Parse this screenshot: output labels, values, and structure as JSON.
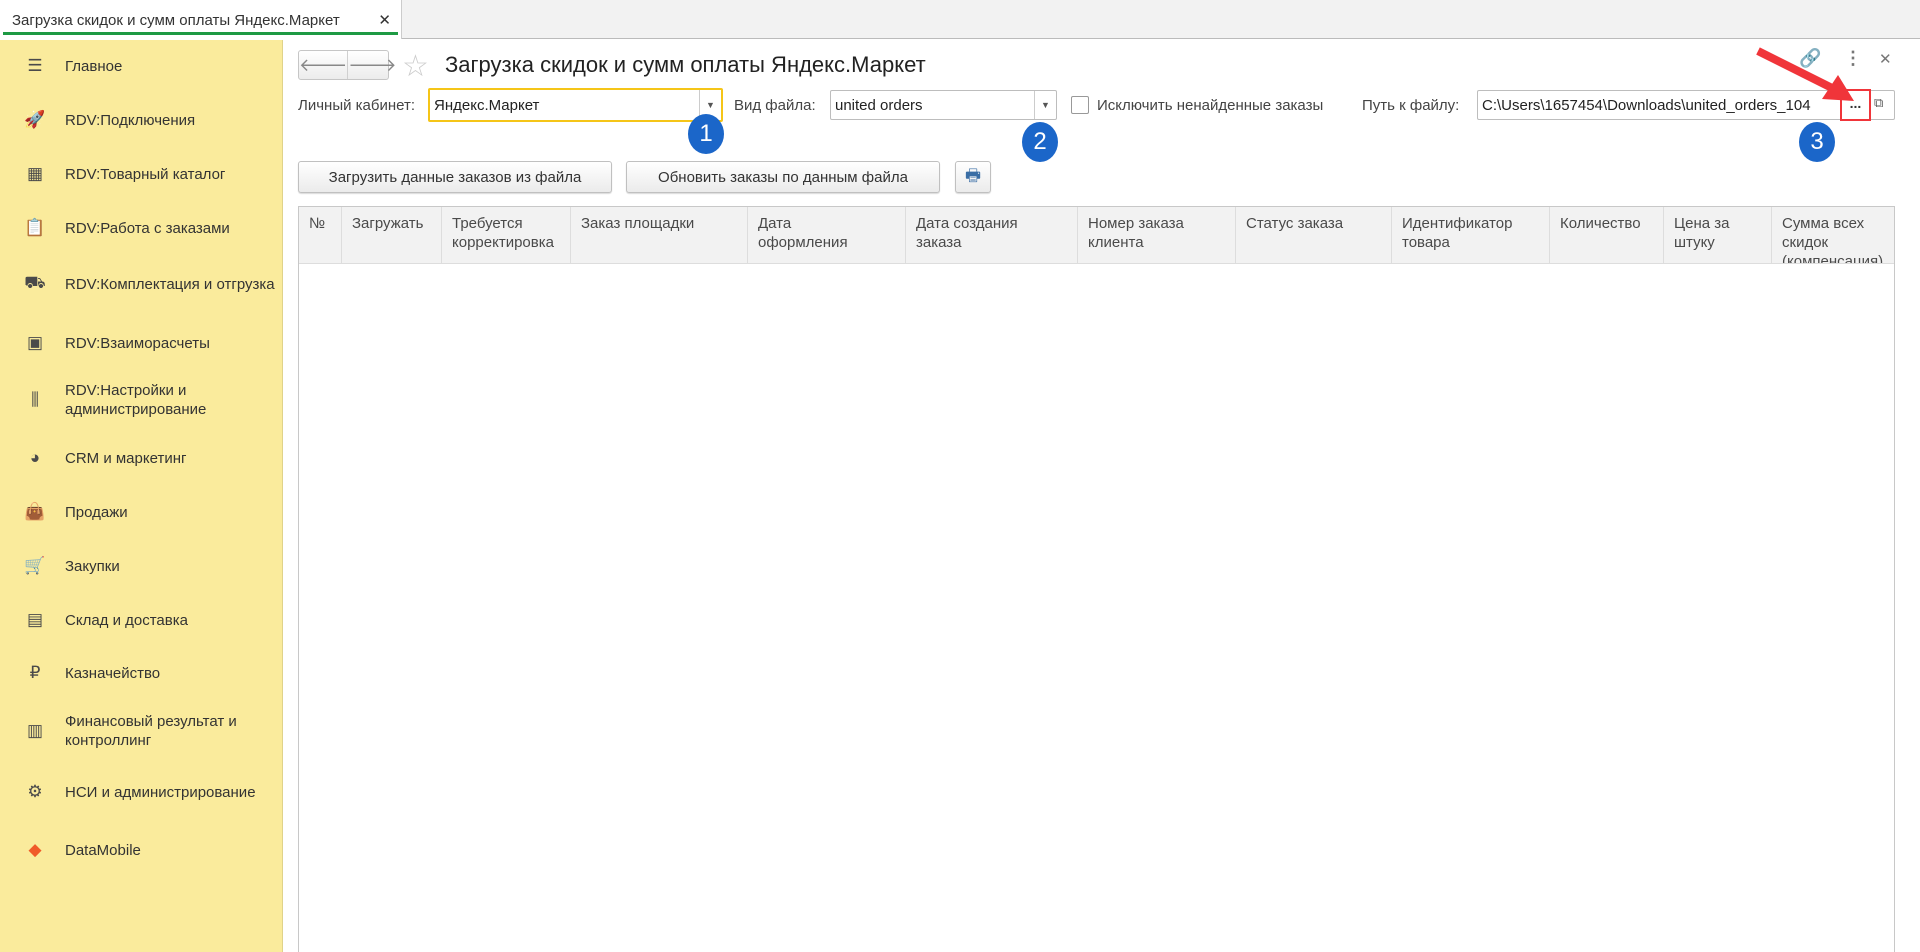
{
  "tab": {
    "title": "Загрузка скидок и сумм оплаты Яндекс.Маркет",
    "close": "✕"
  },
  "sidebar": {
    "items": [
      {
        "label": "Главное",
        "icon": "menu-icon"
      },
      {
        "label": "RDV:Подключения",
        "icon": "rocket-icon"
      },
      {
        "label": "RDV:Товарный каталог",
        "icon": "catalog-icon"
      },
      {
        "label": "RDV:Работа с заказами",
        "icon": "orders-icon"
      },
      {
        "label": "RDV:Комплектация и отгрузка",
        "icon": "cart-box-icon"
      },
      {
        "label": "RDV:Взаиморасчеты",
        "icon": "calculator-icon"
      },
      {
        "label": "RDV:Настройки и администрирование",
        "icon": "sliders-icon"
      },
      {
        "label": "CRM и маркетинг",
        "icon": "pie-chart-icon"
      },
      {
        "label": "Продажи",
        "icon": "bag-icon"
      },
      {
        "label": "Закупки",
        "icon": "cart-icon"
      },
      {
        "label": "Склад и доставка",
        "icon": "warehouse-icon"
      },
      {
        "label": "Казначейство",
        "icon": "ruble-icon"
      },
      {
        "label": "Финансовый результат и контроллинг",
        "icon": "bar-chart-icon"
      },
      {
        "label": "НСИ и администрирование",
        "icon": "gear-icon"
      },
      {
        "label": "DataMobile",
        "icon": "datamobile-logo-icon"
      }
    ]
  },
  "form": {
    "title": "Загрузка скидок и сумм оплаты Яндекс.Маркет",
    "cabinet_label": "Личный кабинет:",
    "cabinet_value": "Яндекс.Маркет",
    "filetype_label": "Вид файла:",
    "filetype_value": "united orders",
    "exclude_label": "Исключить ненайденные заказы",
    "path_label": "Путь к файлу:",
    "path_value": "C:\\Users\\1657454\\Downloads\\united_orders_104",
    "browse": "...",
    "load_button": "Загрузить данные заказов из файла",
    "update_button": "Обновить заказы по данным файла",
    "badges": [
      "1",
      "2",
      "3"
    ]
  },
  "table": {
    "columns": [
      "№",
      "Загружать",
      "Требуется\nкорректировка",
      "Заказ площадки",
      "Дата\nоформления",
      "Дата создания\nзаказа",
      "Номер заказа\nклиента",
      "Статус заказа",
      "Идентификатор\nтовара",
      "Количество",
      "Цена за\nштуку",
      "Сумма всех скидок\n(компенсация)"
    ]
  },
  "colors": {
    "sidebar": "#faeb9c",
    "accent": "#1e9a44",
    "badge": "#1b66c9",
    "highlight": "#f5c518",
    "annotation": "#f0353a"
  }
}
